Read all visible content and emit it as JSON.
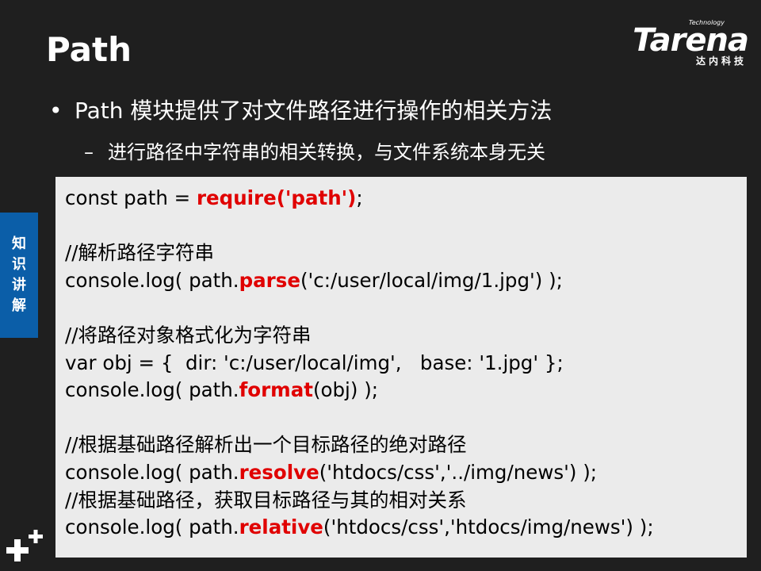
{
  "slide": {
    "title": "Path",
    "logo": {
      "technology": "Technology",
      "brand": "Tarena",
      "chinese": "达内科技"
    },
    "bullet": {
      "marker": "•",
      "text": "Path 模块提供了对文件路径进行操作的相关方法"
    },
    "sub_bullet": {
      "marker": "–",
      "text": "进行路径中字符串的相关转换，与文件系统本身无关"
    },
    "side_tab": [
      "知",
      "识",
      "讲",
      "解"
    ],
    "code": {
      "l1_a": "const path = ",
      "l1_kw": "require('path')",
      "l1_b": ";",
      "c1": "//解析路径字符串",
      "l2_a": "console.log( path.",
      "l2_kw": "parse",
      "l2_b": "('c:/user/local/img/1.jpg') );",
      "c2": "//将路径对象格式化为字符串",
      "l3": "var obj = {  dir: 'c:/user/local/img',   base: '1.jpg' };",
      "l4_a": "console.log( path.",
      "l4_kw": "format",
      "l4_b": "(obj) );",
      "c3": "//根据基础路径解析出一个目标路径的绝对路径",
      "l5_a": "console.log( path.",
      "l5_kw": "resolve",
      "l5_b": "('htdocs/css','../img/news') );",
      "c4": "//根据基础路径，获取目标路径与其的相对关系",
      "l6_a": "console.log( path.",
      "l6_kw": "relative",
      "l6_b": "('htdocs/css','htdocs/img/news') );"
    },
    "colors": {
      "background": "#1f1f1f",
      "code_bg": "#ebebeb",
      "keyword": "#e00000",
      "side_tab": "#0b5ea8"
    },
    "icons": {
      "corner": "plus-icon"
    }
  }
}
